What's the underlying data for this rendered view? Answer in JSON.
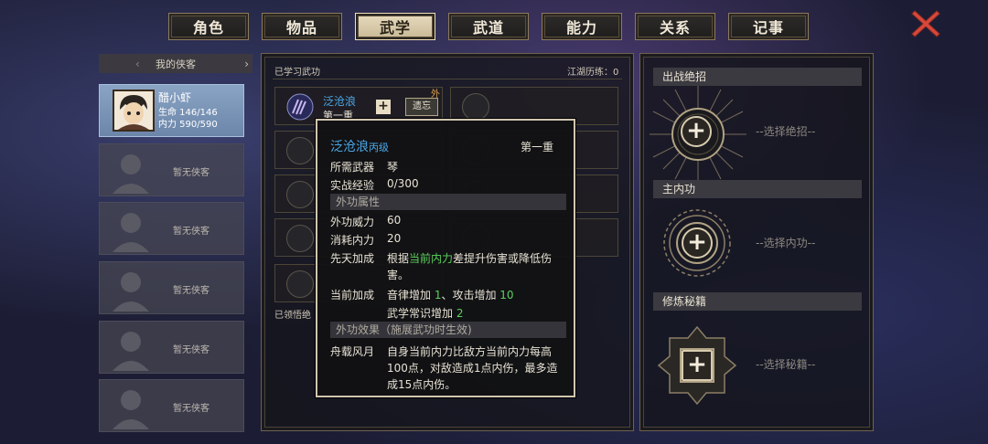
{
  "tabs": [
    "角色",
    "物品",
    "武学",
    "武道",
    "能力",
    "关系",
    "记事"
  ],
  "active_tab": "武学",
  "sidebar": {
    "header": "我的侠客",
    "hero": {
      "name": "醋小虾",
      "hp": "生命 146/146",
      "mp": "内力 590/590"
    },
    "empty_label": "暂无侠客"
  },
  "martial": {
    "learned_title": "已学习武功",
    "jianghu": "江湖历练：0",
    "skill_name": "泛沧浪",
    "skill_level": "第一重",
    "forget_label": "遗忘",
    "external_badge": "外",
    "comprehended_label": "已领悟绝"
  },
  "tooltip": {
    "name": "泛沧浪",
    "grade": "丙级",
    "level": "第一重",
    "weapon_label": "所需武器",
    "weapon": "琴",
    "exp_label": "实战经验",
    "exp": "0/300",
    "section_attr": "外功属性",
    "power_label": "外功威力",
    "power": "60",
    "cost_label": "消耗内力",
    "cost": "20",
    "innate_label": "先天加成",
    "innate_pre": "根据",
    "innate_hl": "当前内力",
    "innate_post": "差提升伤害或降低伤",
    "innate_line2": "害。",
    "bonus_label": "当前加成",
    "bonus_a": "音律增加 ",
    "bonus_a_v": "1",
    "bonus_b": "、攻击增加 ",
    "bonus_b_v": "10",
    "bonus_c": "武学常识增加 ",
    "bonus_c_v": "2",
    "section_effect": "外功效果（施展武功时生效)",
    "effect_label": "舟载风月",
    "effect_l1": "自身当前内力比敌方当前内力每高",
    "effect_l2": "100点，对敌造成1点内伤，最多造",
    "effect_l3": "成15点内伤。"
  },
  "right": {
    "ultimate": "出战绝招",
    "ultimate_choose": "--选择绝招--",
    "inner": "主内功",
    "inner_choose": "--选择内功--",
    "secret": "修炼秘籍",
    "secret_choose": "--选择秘籍--"
  },
  "colors": {
    "highlight_green": "#5cd05c",
    "skill_blue": "#4aa8e8",
    "close_red": "#d8483c"
  }
}
